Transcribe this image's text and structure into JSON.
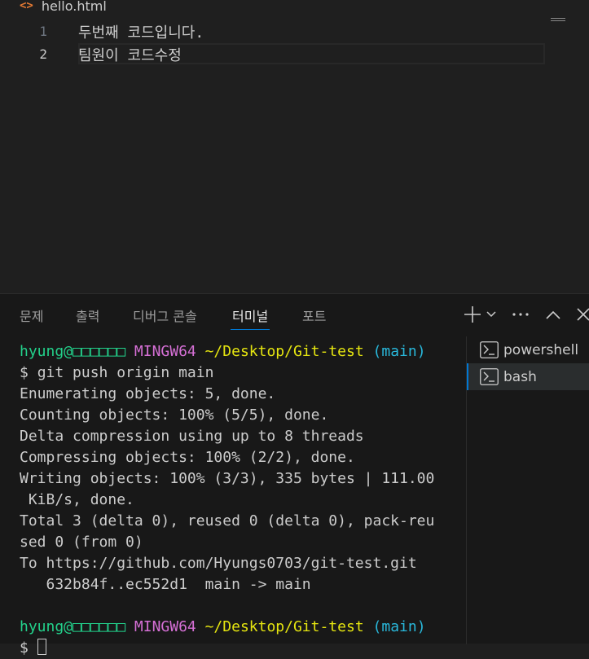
{
  "editor": {
    "file_name": "hello.html",
    "file_icon": "<>",
    "lines": [
      {
        "number": "1",
        "text": "두번째 코드입니다."
      },
      {
        "number": "2",
        "text": "팀원이 코드수정"
      }
    ]
  },
  "panel": {
    "tabs": [
      "문제",
      "출력",
      "디버그 콘솔",
      "터미널",
      "포트"
    ],
    "active_tab": "터미널"
  },
  "terminal": {
    "prompt": {
      "user": "hyung@□□□□□□",
      "shell": "MINGW64",
      "path": "~/Desktop/Git-test",
      "branch": "(main)"
    },
    "prompt_symbol": "$",
    "command": "git push origin main",
    "output": [
      "Enumerating objects: 5, done.",
      "Counting objects: 100% (5/5), done.",
      "Delta compression using up to 8 threads",
      "Compressing objects: 100% (2/2), done.",
      "Writing objects: 100% (3/3), 335 bytes | 111.00",
      " KiB/s, done.",
      "Total 3 (delta 0), reused 0 (delta 0), pack-reu",
      "sed 0 (from 0)",
      "To https://github.com/Hyungs0703/git-test.git",
      "   632b84f..ec552d1  main -> main",
      ""
    ]
  },
  "terminal_list": [
    {
      "name": "powershell",
      "icon": "terminal-icon"
    },
    {
      "name": "bash",
      "icon": "terminal-icon"
    }
  ],
  "colors": {
    "accent": "#0078d4",
    "prompt_user": "#23d18b",
    "prompt_shell": "#d670d6",
    "prompt_path": "#e5e510",
    "prompt_branch": "#29b8db"
  }
}
